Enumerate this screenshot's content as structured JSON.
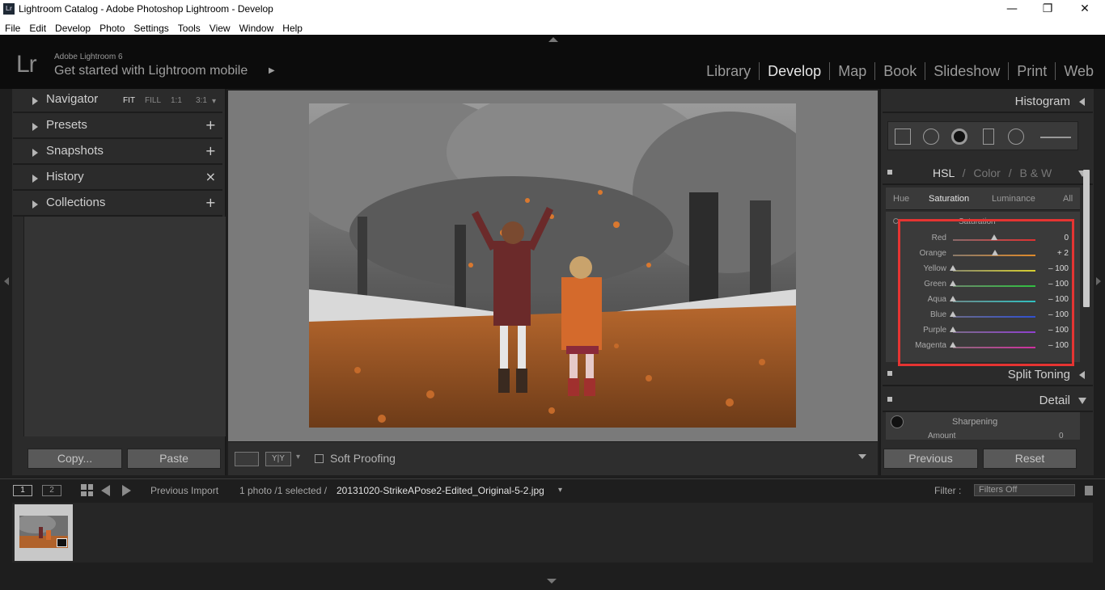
{
  "window": {
    "title": "Lightroom Catalog - Adobe Photoshop Lightroom - Develop",
    "app_icon": "Lr",
    "minimize": "—",
    "maximize": "❐",
    "close": "✕"
  },
  "menu": [
    "File",
    "Edit",
    "Develop",
    "Photo",
    "Settings",
    "Tools",
    "View",
    "Window",
    "Help"
  ],
  "identity": {
    "logo": "Lr",
    "sub": "Adobe Lightroom 6",
    "main": "Get started with Lightroom mobile",
    "arrow": "▶"
  },
  "modules": [
    "Library",
    "Develop",
    "Map",
    "Book",
    "Slideshow",
    "Print",
    "Web"
  ],
  "active_module": "Develop",
  "left_panels": {
    "navigator": {
      "label": "Navigator",
      "zoom": [
        "FIT",
        "FILL",
        "1:1",
        "3:1"
      ],
      "zoom_more": "▾"
    },
    "presets": {
      "label": "Presets",
      "action": "+"
    },
    "snapshots": {
      "label": "Snapshots",
      "action": "+"
    },
    "history": {
      "label": "History",
      "action": "×"
    },
    "collections": {
      "label": "Collections",
      "action": "+"
    }
  },
  "left_buttons": {
    "copy": "Copy...",
    "paste": "Paste"
  },
  "toolbar": {
    "soft_proofing": "Soft Proofing",
    "before_after": "Y|Y",
    "dropdown": "▾"
  },
  "right_panels": {
    "histogram": "Histogram",
    "hsl_header": {
      "hsl": "HSL",
      "sep1": "/",
      "color": "Color",
      "sep2": "/",
      "bw": "B & W"
    },
    "hsl_tabs": [
      "Hue",
      "Saturation",
      "Luminance",
      "All"
    ],
    "active_tab": "Saturation",
    "section_title": "Saturation",
    "sliders": [
      {
        "name": "Red",
        "value": "0",
        "pos": 0.5
      },
      {
        "name": "Orange",
        "value": "+ 2",
        "pos": 0.51
      },
      {
        "name": "Yellow",
        "value": "– 100",
        "pos": 0.0
      },
      {
        "name": "Green",
        "value": "– 100",
        "pos": 0.0
      },
      {
        "name": "Aqua",
        "value": "– 100",
        "pos": 0.0
      },
      {
        "name": "Blue",
        "value": "– 100",
        "pos": 0.0
      },
      {
        "name": "Purple",
        "value": "– 100",
        "pos": 0.0
      },
      {
        "name": "Magenta",
        "value": "– 100",
        "pos": 0.0
      }
    ],
    "split_toning": "Split Toning",
    "detail": "Detail",
    "sharpening": "Sharpening",
    "amount": {
      "label": "Amount",
      "value": "0"
    }
  },
  "right_buttons": {
    "previous": "Previous",
    "reset": "Reset"
  },
  "filmbar": {
    "page1": "1",
    "page2": "2",
    "source": "Previous Import",
    "count": "1 photo /1 selected /",
    "filename": "20131020-StrikeAPose2-Edited_Original-5-2.jpg",
    "file_arrow": "▾",
    "filter_label": "Filter :",
    "filter_value": "Filters Off"
  },
  "colors": {
    "accent_box": "#e53432",
    "panel_bg": "#2b2b2b",
    "active_text": "#e6e6e6"
  },
  "icons": {
    "grid": "grid-icon",
    "prev": "arrow-left-icon",
    "next": "arrow-right-icon"
  }
}
